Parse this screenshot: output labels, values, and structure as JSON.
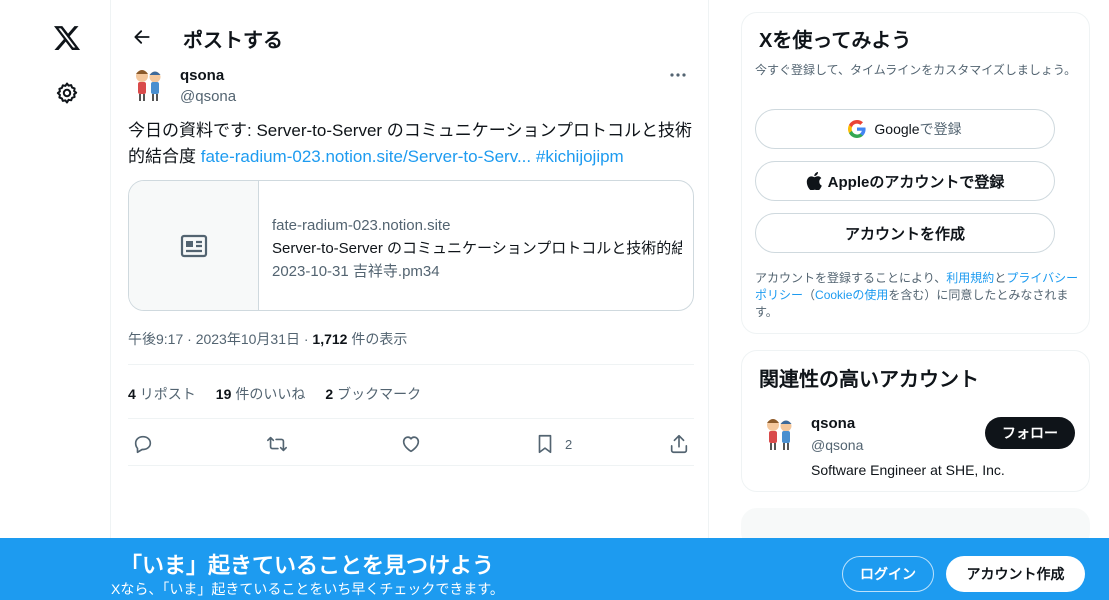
{
  "nav": {
    "logo_icon": "x-logo-icon",
    "settings_icon": "gear-icon"
  },
  "header": {
    "title": "ポストする",
    "back_icon": "arrow-left-icon"
  },
  "post": {
    "author_name": "qsona",
    "author_handle": "@qsona",
    "text_plain": "今日の資料です: Server-to-Server のコミュニケーションプロトコルと技術的結合度 ",
    "link_text": "fate-radium-023.notion.site/Server-to-Serv...",
    "hashtag": "#kichijojipm",
    "card": {
      "domain": "fate-radium-023.notion.site",
      "title": "Server-to-Server のコミュニケーションプロトコルと技術的結",
      "description": "2023-10-31 吉祥寺.pm34"
    },
    "meta": {
      "time_date": "午後9:17 · 2023年10月31日 · ",
      "views_count": "1,712",
      "views_label": " 件の表示"
    },
    "stats": {
      "reposts_count": "4",
      "reposts_label": "リポスト",
      "likes_count": "19",
      "likes_label": "件のいいね",
      "bookmarks_count": "2",
      "bookmarks_label": "ブックマーク"
    },
    "actions": {
      "bookmark_count": "2"
    }
  },
  "signup": {
    "title": "Xを使ってみよう",
    "subtitle": "今すぐ登録して、タイムラインをカスタマイズしましょう。",
    "google_label": "Google",
    "google_sub": " で登録",
    "apple_label": "Appleのアカウントで登録",
    "create_label": "アカウントを作成",
    "terms_1": "アカウントを登録することにより、",
    "terms_link1": "利用規約",
    "terms_2": "と",
    "terms_link2": "プライバシーポリシー",
    "terms_3": "（",
    "terms_link3": "Cookieの使用",
    "terms_4": "を含む）に同意したとみなされます。"
  },
  "related": {
    "title": "関連性の高いアカウント",
    "name": "qsona",
    "handle": "@qsona",
    "bio": "Software Engineer at SHE, Inc.",
    "follow_label": "フォロー"
  },
  "banner": {
    "title": "「いま」起きていることを見つけよう",
    "subtitle": "Xなら、「いま」起きていることをいち早くチェックできます。",
    "login_label": "ログイン",
    "create_label": "アカウント作成"
  },
  "colors": {
    "accent": "#1d9bf0",
    "text": "#0f1419",
    "muted": "#536471",
    "border": "#eff3f4"
  }
}
